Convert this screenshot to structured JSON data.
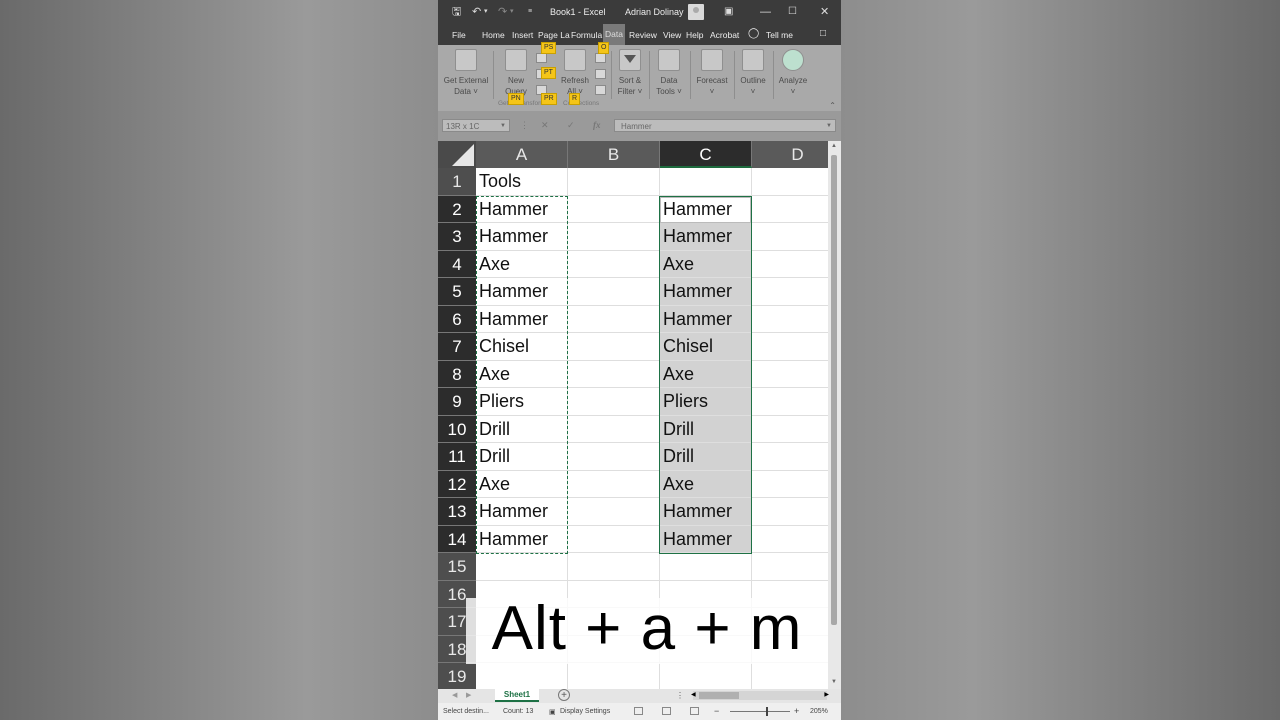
{
  "titlebar": {
    "title": "Book1  -  Excel",
    "user": "Adrian Dolinay",
    "qat": [
      "save-icon",
      "undo-icon",
      "redo-icon",
      "customize-icon"
    ],
    "window_buttons": [
      "ribbon-display-icon",
      "minimize-icon",
      "maximize-icon",
      "close-icon"
    ]
  },
  "tabs": [
    "File",
    "Home",
    "Insert",
    "Page La",
    "Formula",
    "Data",
    "Review",
    "View",
    "Help",
    "Acrobat"
  ],
  "active_tab": "Data",
  "tell_me": "Tell me",
  "ribbon": {
    "get_external_data": "Get External\nData",
    "new_query": "New\nQuery",
    "refresh_all": "Refresh\nAll",
    "sort_filter": "Sort &\nFilter",
    "data_tools": "Data\nTools",
    "forecast": "Forecast",
    "outline": "Outline",
    "analyze": "Analyze",
    "group_get_transform": "Get & Transform",
    "group_connections": "Connections"
  },
  "keytips": [
    "ZX",
    "PS",
    "PT",
    "PN",
    "PR",
    "O",
    "R",
    "ZS",
    "ZD",
    "Z2",
    "ZO",
    "Z3"
  ],
  "formula_bar": {
    "name_box": "13R x 1C",
    "value": "Hammer"
  },
  "columns": [
    "A",
    "B",
    "C",
    "D"
  ],
  "selected_column": "C",
  "rows": [
    {
      "n": "1",
      "A": "Tools",
      "C": ""
    },
    {
      "n": "2",
      "A": "Hammer",
      "C": "Hammer"
    },
    {
      "n": "3",
      "A": "Hammer",
      "C": "Hammer"
    },
    {
      "n": "4",
      "A": "Axe",
      "C": "Axe"
    },
    {
      "n": "5",
      "A": "Hammer",
      "C": "Hammer"
    },
    {
      "n": "6",
      "A": "Hammer",
      "C": "Hammer"
    },
    {
      "n": "7",
      "A": "Chisel",
      "C": "Chisel"
    },
    {
      "n": "8",
      "A": "Axe",
      "C": "Axe"
    },
    {
      "n": "9",
      "A": "Pliers",
      "C": "Pliers"
    },
    {
      "n": "10",
      "A": "Drill",
      "C": "Drill"
    },
    {
      "n": "11",
      "A": "Drill",
      "C": "Drill"
    },
    {
      "n": "12",
      "A": "Axe",
      "C": "Axe"
    },
    {
      "n": "13",
      "A": "Hammer",
      "C": "Hammer"
    },
    {
      "n": "14",
      "A": "Hammer",
      "C": "Hammer"
    },
    {
      "n": "15",
      "A": "",
      "C": ""
    },
    {
      "n": "16",
      "A": "",
      "C": ""
    },
    {
      "n": "17",
      "A": "",
      "C": ""
    },
    {
      "n": "18",
      "A": "",
      "C": ""
    },
    {
      "n": "19",
      "A": "",
      "C": ""
    }
  ],
  "sheet_tab": "Sheet1",
  "status": {
    "mode": "Select destin...",
    "count": "Count: 13",
    "display_settings": "Display Settings",
    "zoom": "205%"
  },
  "overlay_caption": "Alt + a + m"
}
